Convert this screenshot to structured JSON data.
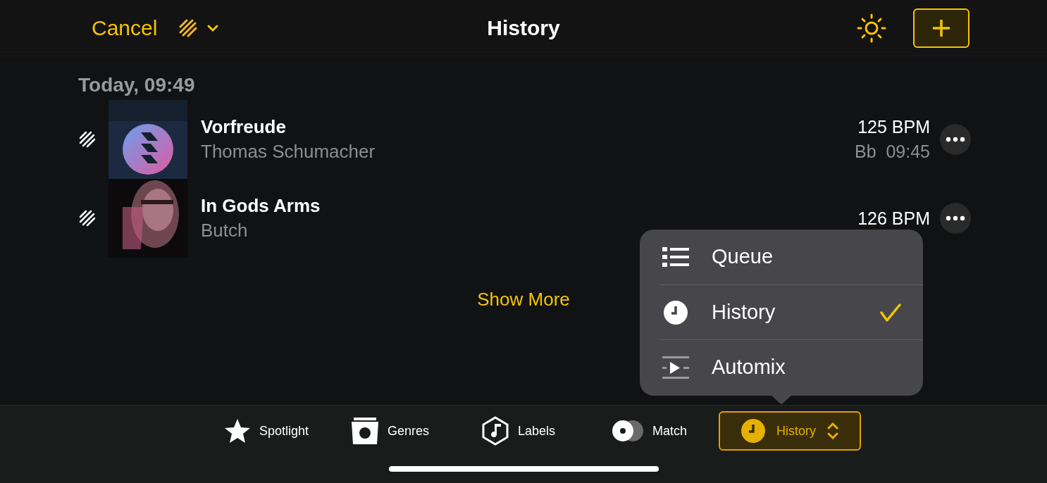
{
  "top_bar": {
    "cancel": "Cancel",
    "title": "History"
  },
  "section": {
    "heading": "Today, 09:49"
  },
  "tracks": [
    {
      "title": "Vorfreude",
      "artist": "Thomas Schumacher",
      "bpm": "125 BPM",
      "key_time": "Bb  09:45"
    },
    {
      "title": "In Gods Arms",
      "artist": "Butch",
      "bpm": "126 BPM"
    }
  ],
  "show_more": "Show More",
  "menu": {
    "items": [
      {
        "label": "Queue",
        "kind": "list",
        "selected": false
      },
      {
        "label": "History",
        "kind": "clock",
        "selected": true
      },
      {
        "label": "Automix",
        "kind": "automix",
        "selected": false
      }
    ]
  },
  "tabs": [
    {
      "label": "Spotlight",
      "kind": "star",
      "selected": false
    },
    {
      "label": "Genres",
      "kind": "genres",
      "selected": false
    },
    {
      "label": "Labels",
      "kind": "labels",
      "selected": false
    },
    {
      "label": "Match",
      "kind": "match",
      "selected": false
    },
    {
      "label": "History",
      "kind": "clock",
      "selected": true
    }
  ]
}
